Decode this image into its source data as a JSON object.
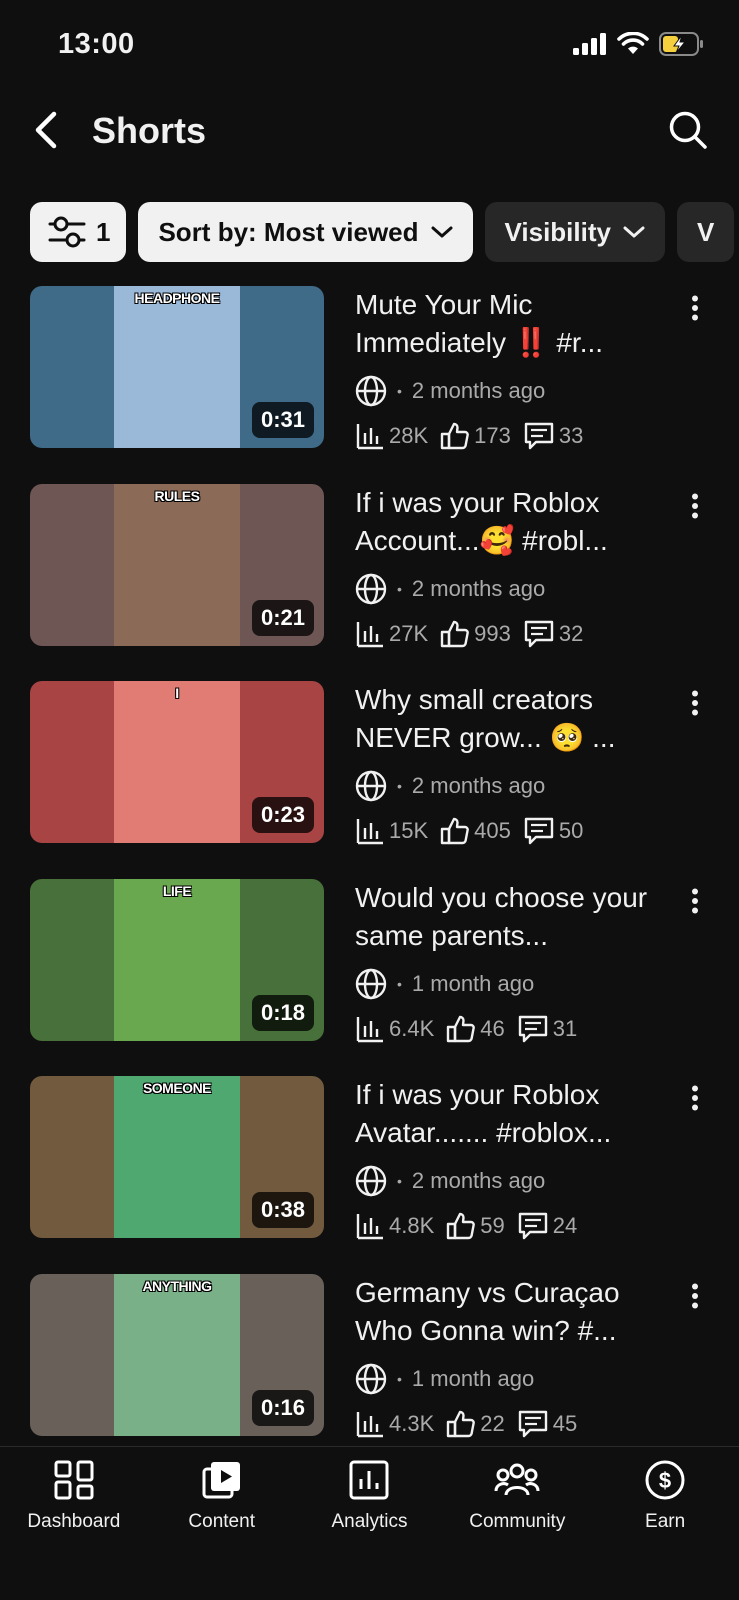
{
  "status_bar": {
    "time": "13:00"
  },
  "header": {
    "title": "Shorts"
  },
  "filters": {
    "filter_count": "1",
    "sort_label": "Sort by: Most viewed",
    "visibility_label": "Visibility",
    "next_chip_partial": "V"
  },
  "videos": [
    {
      "title": "Mute Your Mic Immediately ‼️ #r...",
      "age": "2 months ago",
      "views": "28K",
      "likes": "173",
      "comments": "33",
      "duration": "0:31",
      "thumb_text": "HEADPHONE",
      "side_color": "#3f6a88",
      "center_color": "#9ab8d8"
    },
    {
      "title": "If i was your Roblox Account...🥰 #robl...",
      "age": "2 months ago",
      "views": "27K",
      "likes": "993",
      "comments": "32",
      "duration": "0:21",
      "thumb_text": "RULES",
      "side_color": "#6e5654",
      "center_color": "#8b6a58"
    },
    {
      "title": "Why small creators NEVER grow... 🥺 ...",
      "age": "2 months ago",
      "views": "15K",
      "likes": "405",
      "comments": "50",
      "duration": "0:23",
      "thumb_text": "I",
      "side_color": "#a84444",
      "center_color": "#e07c74"
    },
    {
      "title": "Would you choose your same parents...",
      "age": "1 month ago",
      "views": "6.4K",
      "likes": "46",
      "comments": "31",
      "duration": "0:18",
      "thumb_text": "LIFE",
      "side_color": "#48703a",
      "center_color": "#6aa850"
    },
    {
      "title": "If i was your Roblox Avatar.......  #roblox...",
      "age": "2 months ago",
      "views": "4.8K",
      "likes": "59",
      "comments": "24",
      "duration": "0:38",
      "thumb_text": "SOMEONE",
      "side_color": "#725a3e",
      "center_color": "#4ea870"
    },
    {
      "title": "Germany vs Curaçao Who Gonna win? #...",
      "age": "1 month ago",
      "views": "4.3K",
      "likes": "22",
      "comments": "45",
      "duration": "0:16",
      "thumb_text": "ANYTHING",
      "side_color": "#6a605a",
      "center_color": "#7ab088"
    }
  ],
  "bottom_nav": [
    {
      "label": "Dashboard",
      "icon": "dashboard-icon"
    },
    {
      "label": "Content",
      "icon": "content-icon"
    },
    {
      "label": "Analytics",
      "icon": "analytics-icon"
    },
    {
      "label": "Community",
      "icon": "community-icon"
    },
    {
      "label": "Earn",
      "icon": "earn-icon"
    }
  ]
}
